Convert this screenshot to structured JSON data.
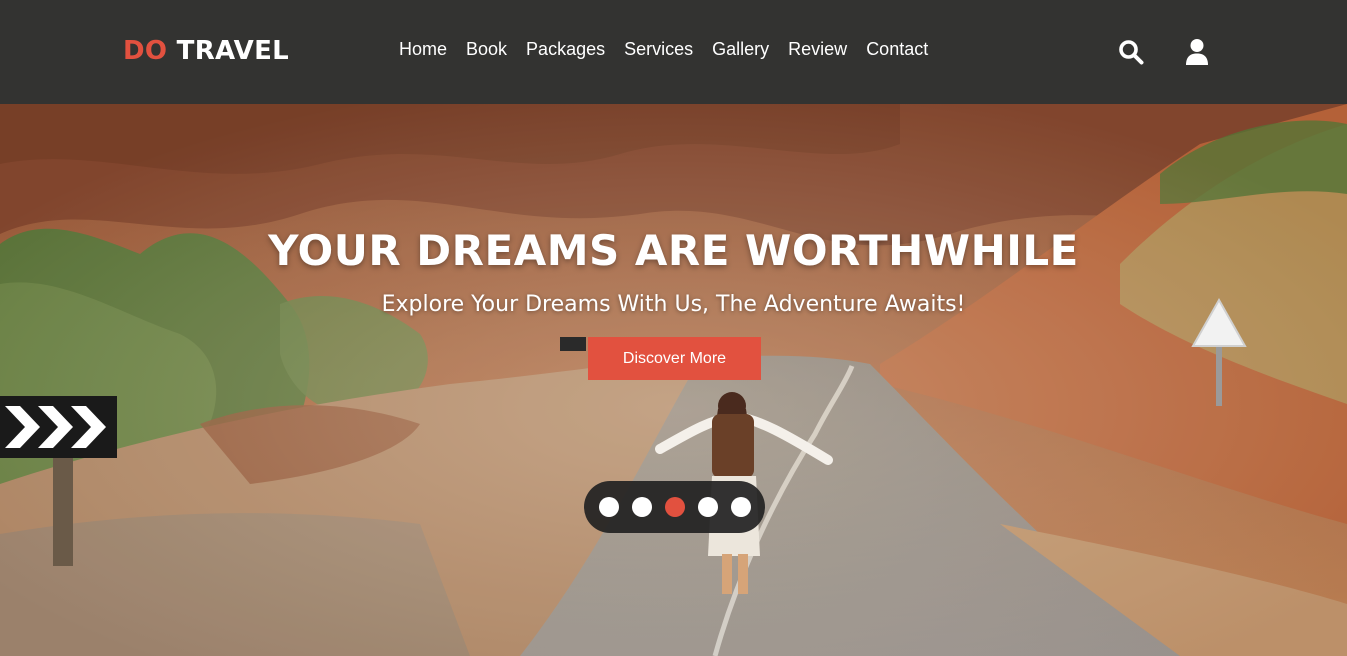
{
  "logo": {
    "accent": "DO",
    "rest": "TRAVEL"
  },
  "nav": {
    "items": [
      "Home",
      "Book",
      "Packages",
      "Services",
      "Gallery",
      "Review",
      "Contact"
    ]
  },
  "header_icons": {
    "search": "search-icon",
    "user": "user-icon"
  },
  "hero": {
    "title": "YOUR DREAMS ARE WORTHWHILE",
    "subtitle": "Explore Your Dreams With Us, The Adventure Awaits!",
    "cta_label": "Discover More"
  },
  "slider": {
    "count": 5,
    "active_index": 2
  },
  "colors": {
    "accent": "#e2513f",
    "header_bg": "#333331",
    "text": "#ffffff"
  }
}
